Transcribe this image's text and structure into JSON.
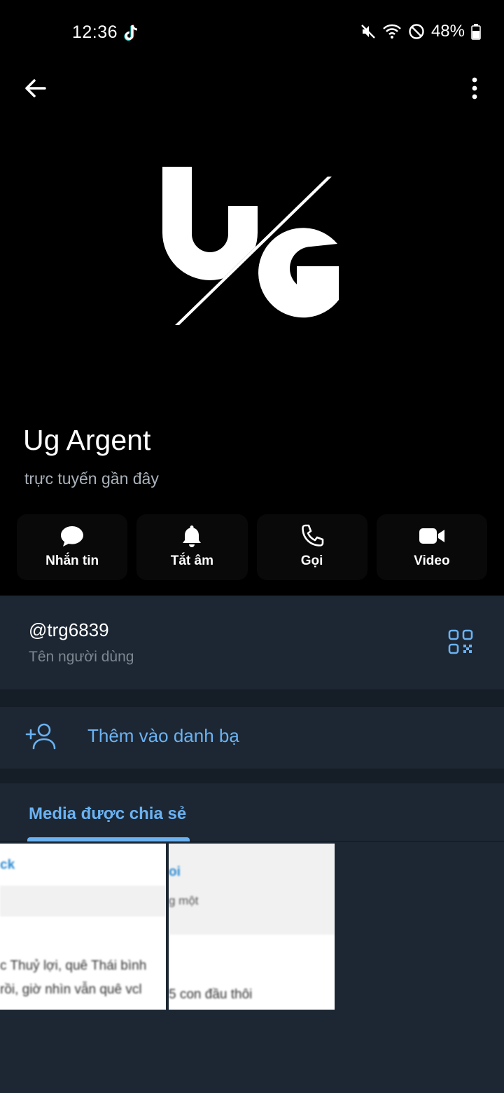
{
  "status_bar": {
    "time": "12:36",
    "battery": "48%"
  },
  "profile": {
    "name": "Ug Argent",
    "status": "trực tuyến gần đây",
    "logo_text": "UG"
  },
  "actions": [
    {
      "label": "Nhắn tin",
      "icon": "message-icon"
    },
    {
      "label": "Tắt âm",
      "icon": "bell-icon"
    },
    {
      "label": "Gọi",
      "icon": "phone-icon"
    },
    {
      "label": "Video",
      "icon": "video-icon"
    }
  ],
  "username": {
    "value": "@trg6839",
    "label": "Tên người dùng"
  },
  "add_contact": {
    "label": "Thêm vào danh bạ"
  },
  "media": {
    "tab_label": "Media được chia sẻ",
    "thumb1": {
      "title": "ck",
      "line1": "c Thuỷ lợi, quê Thái bình",
      "line2": "rồi, giờ nhìn vẫn quê vcl"
    },
    "thumb2": {
      "title": "oi",
      "sub": "g một",
      "line1": "5 con đầu thôi"
    }
  },
  "colors": {
    "accent": "#6ab2f2",
    "background": "#1d2733",
    "header": "#000000"
  }
}
